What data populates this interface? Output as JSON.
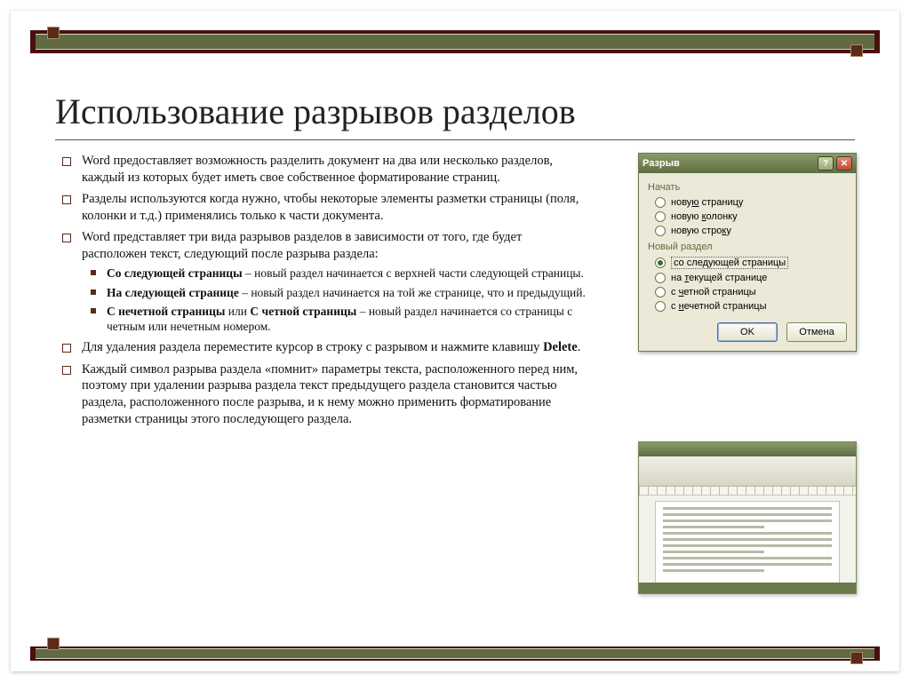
{
  "title": "Использование разрывов разделов",
  "bullets": {
    "b1": "Word предоставляет возможность разделить документ на два или несколько разделов, каждый из которых будет иметь свое собственное форматирование страниц.",
    "b2": "Разделы используются когда нужно, чтобы некоторые элементы разметки страницы (поля, колонки и т.д.) применялись только к части документа.",
    "b3": "Word представляет три вида разрывов разделов в зависимости от того, где будет расположен текст, следующий после разрыва раздела:",
    "b3a_bold": "Со следующей страницы",
    "b3a_rest": " – новый раздел начинается с верхней части следующей страницы.",
    "b3b_bold": "На следующей странице",
    "b3b_rest": " – новый раздел начинается на той же странице, что и предыдущий.",
    "b3c_bold1": "С нечетной страницы",
    "b3c_mid": " или ",
    "b3c_bold2": "С четной страницы",
    "b3c_rest": " – новый раздел начинается со страницы с четным или нечетным номером.",
    "b4_pre": "Для удаления раздела переместите курсор в строку с разрывом и нажмите клавишу ",
    "b4_bold": "Delete",
    "b4_post": ".",
    "b5": "Каждый символ разрыва раздела «помнит» параметры текста, расположенного перед ним, поэтому при удалении разрыва раздела текст предыдущего раздела становится частью раздела, расположенного после разрыва, и к нему можно применить форматирование разметки страницы этого последующего раздела."
  },
  "dialog": {
    "title": "Разрыв",
    "group1": "Начать",
    "opt_page": "новую страницу",
    "opt_column": "новую колонку",
    "opt_line": "новую строку",
    "group2": "Новый раздел",
    "opt_next": "со следующей страницы",
    "opt_cur": "на текущей странице",
    "opt_even": "с четной страницы",
    "opt_odd": "с нечетной страницы",
    "ok": "OK",
    "cancel": "Отмена",
    "help_char": "?",
    "close_char": "✕"
  }
}
